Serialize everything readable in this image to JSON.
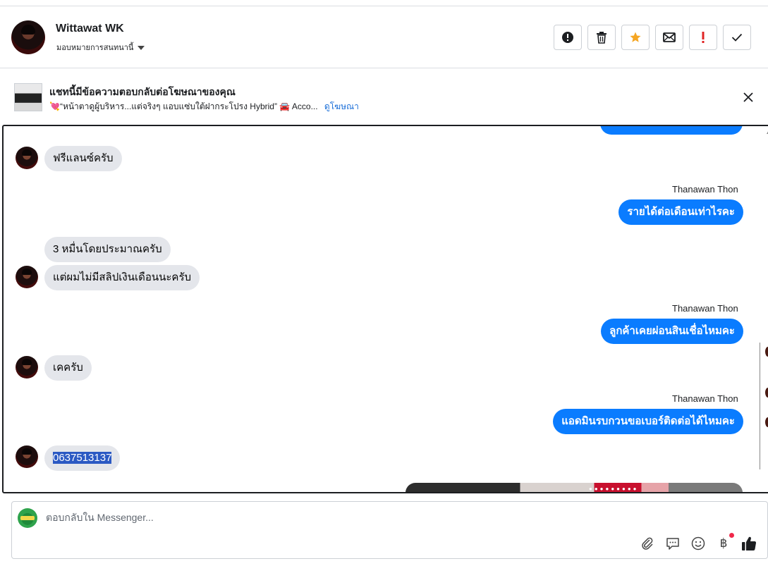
{
  "header": {
    "contact_name": "Wittawat WK",
    "assign_label": "มอบหมายการสนทนานี้",
    "actions": [
      {
        "name": "report-button",
        "icon": "exclamation-circle-icon"
      },
      {
        "name": "delete-button",
        "icon": "trash-icon"
      },
      {
        "name": "star-button",
        "icon": "star-icon",
        "color": "#f5a623"
      },
      {
        "name": "mark-unread-button",
        "icon": "envelope-icon"
      },
      {
        "name": "follow-up-button",
        "icon": "exclamation-icon",
        "color": "#e02424"
      },
      {
        "name": "mark-done-button",
        "icon": "check-icon"
      }
    ]
  },
  "ad_banner": {
    "title": "แชทนี้มีข้อความตอบกลับต่อโฆษณาของคุณ",
    "subtitle": "💘“หน้าตาดูผู้บริหาร...แต่จริงๆ แอบแซ่บใต้ฝากระโปรง Hybrid” 🚘 Acco...",
    "link": "ดูโฆษณา"
  },
  "messages": {
    "m1": "ฟรีแลนซ์ครับ",
    "s1": "Thanawan Thon",
    "m2": "รายได้ต่อเดือนเท่าไรคะ",
    "m3": "3 หมื่นโดยประมาณครับ",
    "m4": "แต่ผมไม่มีสลิปเงินเดือนนะครับ",
    "s2": "Thanawan Thon",
    "m5": "ลูกค้าเคยผ่อนสินเชื่อไหมคะ",
    "m6": "เคครับ",
    "s3": "Thanawan Thon",
    "m7": "แอดมินรบกวนขอเบอร์ติดต่อได้ไหมคะ",
    "m8": "0637513137"
  },
  "reply": {
    "placeholder": "ตอบกลับใน Messenger...",
    "tools": [
      "paperclip-icon",
      "speech-bubble-icon",
      "smiley-icon",
      "baht-icon",
      "thumbs-up-icon"
    ],
    "baht_symbol": "฿"
  },
  "colors": {
    "outgoing": "#0a7cff",
    "incoming": "#e4e6eb",
    "link": "#1a6ed8"
  }
}
